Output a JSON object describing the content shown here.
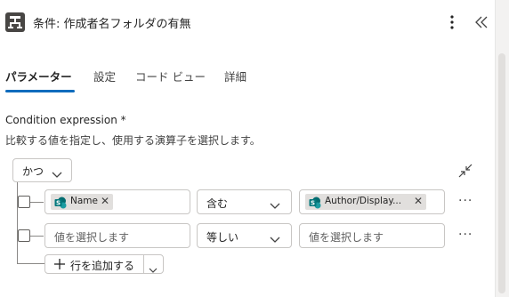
{
  "header": {
    "title": "条件: 作成者名フォルダの有無",
    "icon": "condition-flow-icon",
    "more_icon": "more-vertical-icon",
    "collapse_icon": "double-chevron-left-icon"
  },
  "tabs": [
    {
      "label": "パラメーター",
      "active": true
    },
    {
      "label": "設定",
      "active": false
    },
    {
      "label": "コード ビュー",
      "active": false
    },
    {
      "label": "詳細",
      "active": false
    }
  ],
  "condition": {
    "label": "Condition expression",
    "required_marker": "*",
    "description": "比較する値を指定し、使用する演算子を選択します。",
    "group_operator": "かつ",
    "rows": [
      {
        "left_token": "Name",
        "operator": "含む",
        "right_token": "Author/Display..."
      },
      {
        "left_placeholder": "値を選択します",
        "operator": "等しい",
        "right_placeholder": "値を選択します"
      }
    ],
    "add_row_label": "行を追加する",
    "row_more": "···"
  },
  "colors": {
    "accent": "#0f6cbd",
    "sharepoint_teal": "#03787c",
    "border": "#c8c6c4"
  }
}
